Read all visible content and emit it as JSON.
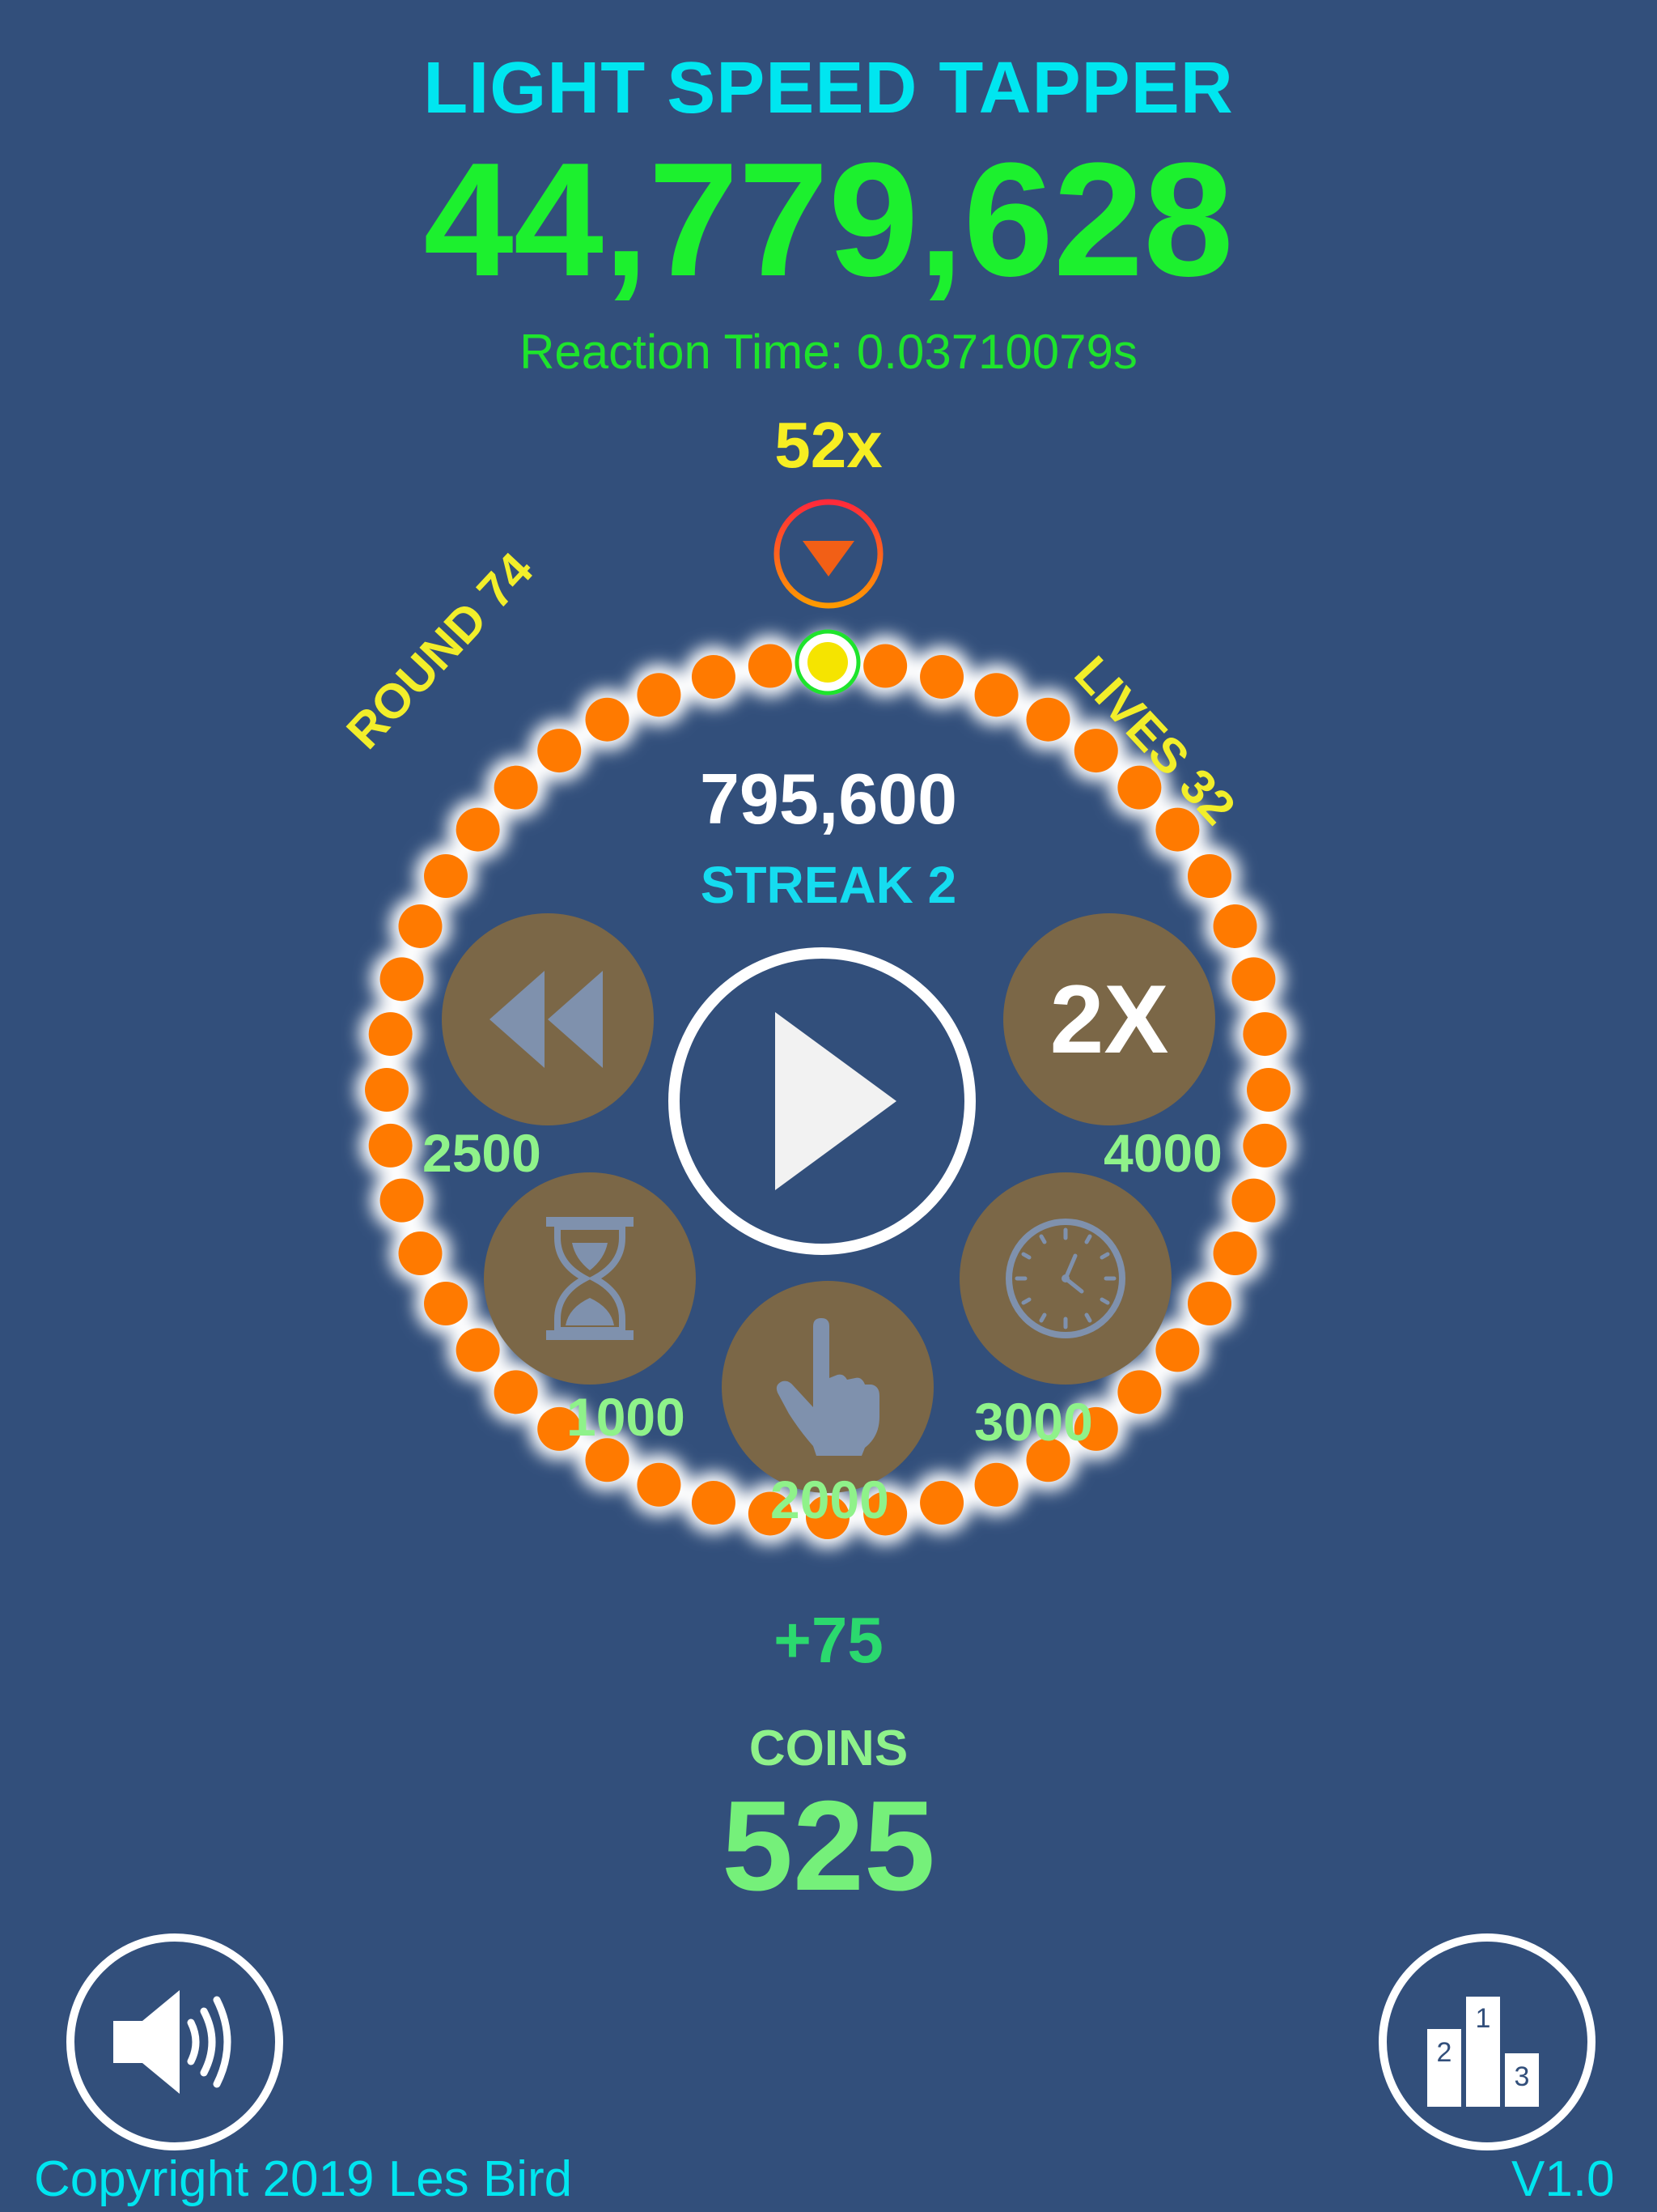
{
  "game": {
    "title": "LIGHT SPEED TAPPER",
    "score": "44,779,628",
    "reaction_time": "Reaction Time: 0.03710079s",
    "multiplier": "52x",
    "round": "ROUND 74",
    "lives": "LIVES 32",
    "round_score": "795,600",
    "streak": "STREAK 2",
    "gain": "+75",
    "coins_label": "COINS",
    "coins_value": "525"
  },
  "powerups": {
    "rewind": {
      "icon": "rewind-icon",
      "cost": "2500"
    },
    "double": {
      "label": "2X",
      "cost": "4000"
    },
    "hourglass": {
      "icon": "hourglass-icon",
      "cost": "1000"
    },
    "tap": {
      "icon": "tap-finger-icon",
      "cost": "2000"
    },
    "clock": {
      "icon": "clock-icon",
      "cost": "3000"
    }
  },
  "controls": {
    "play": {
      "icon": "play-icon"
    },
    "sound": {
      "icon": "speaker-icon"
    },
    "leaderboard": {
      "icon": "podium-icon",
      "places": [
        "1",
        "2",
        "3"
      ]
    }
  },
  "footer": {
    "copyright": "Copyright 2019 Les Bird",
    "version": "V1.0"
  },
  "colors": {
    "background": "#324f7b",
    "title": "#00e6f0",
    "score": "#1cf02e",
    "dots": "#ff7a00",
    "target_dot": "#f5e400",
    "powerup_bg": "#7b6747"
  }
}
